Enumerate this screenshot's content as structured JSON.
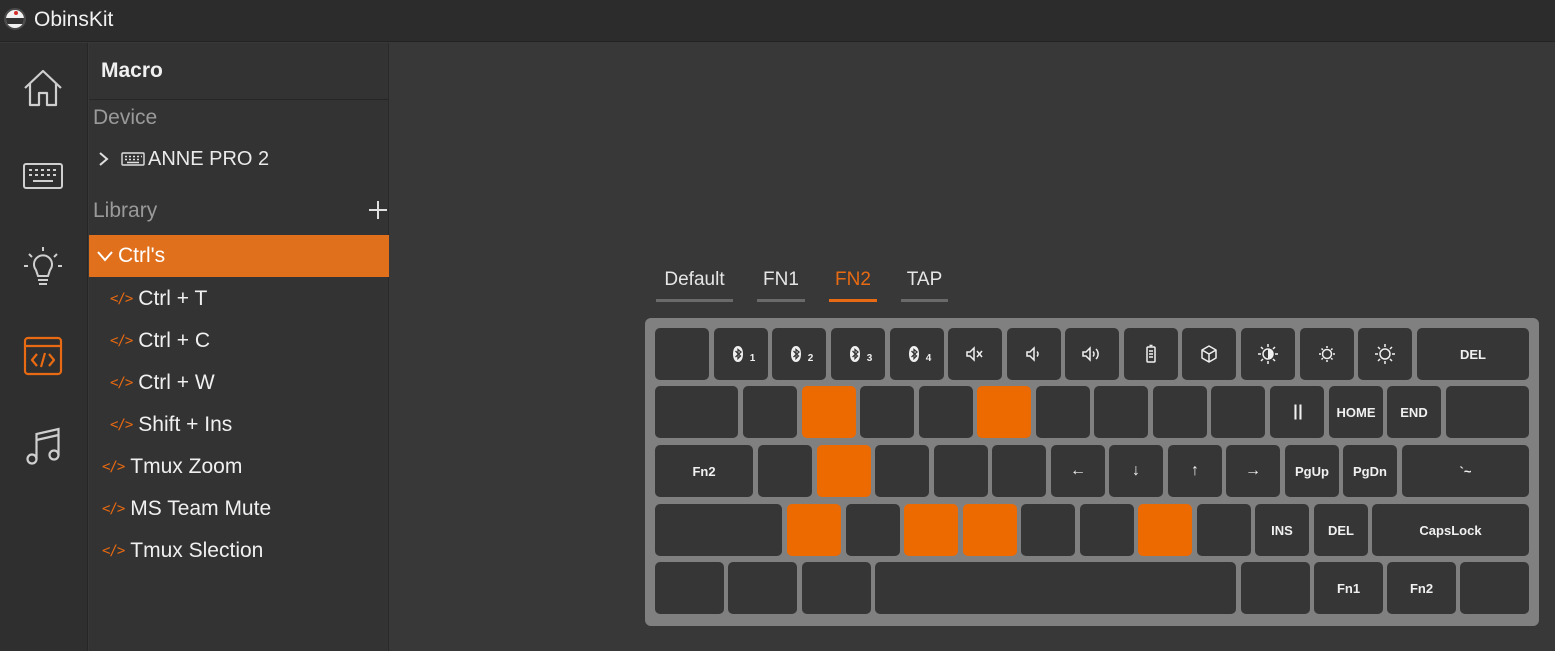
{
  "app": {
    "title": "ObinsKit",
    "logo_text": "obins"
  },
  "nav": [
    {
      "name": "home-icon",
      "active": false
    },
    {
      "name": "keyboard-icon",
      "active": false
    },
    {
      "name": "lighting-icon",
      "active": false
    },
    {
      "name": "macro-icon",
      "active": true
    },
    {
      "name": "music-icon",
      "active": false
    }
  ],
  "sidebar": {
    "header": "Macro",
    "device_label": "Device",
    "device_name": "ANNE PRO 2",
    "library_label": "Library",
    "selected_folder": "Ctrl's",
    "folder_items": [
      "Ctrl + T",
      "Ctrl + C",
      "Ctrl + W",
      "Shift + Ins"
    ],
    "root_items": [
      "Tmux Zoom",
      "MS Team Mute",
      "Tmux Slection"
    ]
  },
  "tabs": [
    {
      "label": "Default",
      "active": false
    },
    {
      "label": "FN1",
      "active": false
    },
    {
      "label": "FN2",
      "active": true
    },
    {
      "label": "TAP",
      "active": false
    }
  ],
  "colors": {
    "accent": "#e86a12",
    "highlight_key": "#ec6a00",
    "key": "#363636",
    "board": "#808080"
  },
  "keyboard": {
    "rows": [
      [
        {
          "label": ""
        },
        {
          "icon": "bluetooth-icon",
          "sub": "1"
        },
        {
          "icon": "bluetooth-icon",
          "sub": "2"
        },
        {
          "icon": "bluetooth-icon",
          "sub": "3"
        },
        {
          "icon": "bluetooth-icon",
          "sub": "4"
        },
        {
          "icon": "mute-icon"
        },
        {
          "icon": "volume-down-icon"
        },
        {
          "icon": "volume-up-icon"
        },
        {
          "icon": "battery-icon"
        },
        {
          "icon": "cube-icon"
        },
        {
          "icon": "light-mode-icon"
        },
        {
          "icon": "brightness-down-icon"
        },
        {
          "icon": "brightness-up-icon"
        },
        {
          "label": "DEL"
        }
      ],
      [
        {
          "label": ""
        },
        {
          "label": ""
        },
        {
          "label": "",
          "hl": true
        },
        {
          "label": ""
        },
        {
          "label": ""
        },
        {
          "label": "",
          "hl": true
        },
        {
          "label": ""
        },
        {
          "label": ""
        },
        {
          "label": ""
        },
        {
          "label": ""
        },
        {
          "label": "| |"
        },
        {
          "label": "HOME"
        },
        {
          "label": "END"
        },
        {
          "label": ""
        }
      ],
      [
        {
          "label": "Fn2"
        },
        {
          "label": ""
        },
        {
          "label": "",
          "hl": true
        },
        {
          "label": ""
        },
        {
          "label": ""
        },
        {
          "label": ""
        },
        {
          "label": "←"
        },
        {
          "label": "↓"
        },
        {
          "label": "↑"
        },
        {
          "label": "→"
        },
        {
          "label": "PgUp"
        },
        {
          "label": "PgDn"
        },
        {
          "label": "`~"
        }
      ],
      [
        {
          "label": ""
        },
        {
          "label": "",
          "hl": true
        },
        {
          "label": ""
        },
        {
          "label": "",
          "hl": true
        },
        {
          "label": "",
          "hl": true
        },
        {
          "label": ""
        },
        {
          "label": ""
        },
        {
          "label": "",
          "hl": true
        },
        {
          "label": ""
        },
        {
          "label": "INS"
        },
        {
          "label": "DEL"
        },
        {
          "label": "CapsLock"
        }
      ],
      [
        {
          "label": ""
        },
        {
          "label": ""
        },
        {
          "label": ""
        },
        {
          "label": ""
        },
        {
          "label": ""
        },
        {
          "label": "Fn1"
        },
        {
          "label": "Fn2"
        },
        {
          "label": ""
        }
      ]
    ]
  }
}
